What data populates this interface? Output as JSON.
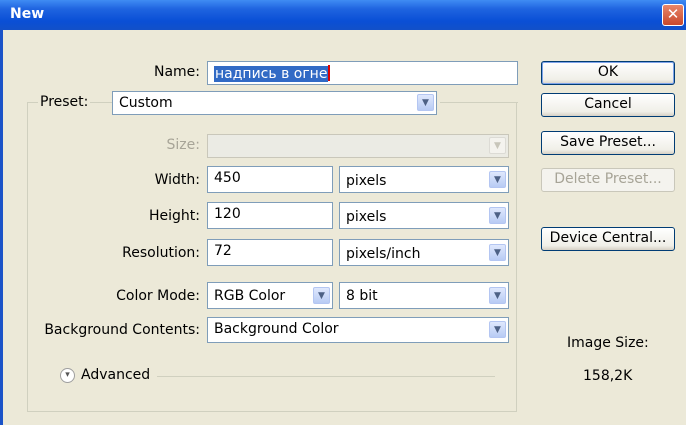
{
  "window": {
    "title": "New",
    "close_glyph": "✕"
  },
  "form": {
    "name_label": "Name:",
    "name_value": "надпись в огне",
    "preset_label": "Preset:",
    "preset_value": "Custom",
    "size_label": "Size:",
    "size_value": "",
    "width_label": "Width:",
    "width_value": "450",
    "width_unit": "pixels",
    "height_label": "Height:",
    "height_value": "120",
    "height_unit": "pixels",
    "resolution_label": "Resolution:",
    "resolution_value": "72",
    "resolution_unit": "pixels/inch",
    "color_mode_label": "Color Mode:",
    "color_mode_value": "RGB Color",
    "bit_depth_value": "8 bit",
    "background_label": "Background Contents:",
    "background_value": "Background Color",
    "advanced_label": "Advanced",
    "advanced_icon": "expand-chevron-icon"
  },
  "buttons": {
    "ok": "OK",
    "cancel": "Cancel",
    "save_preset": "Save Preset...",
    "delete_preset": "Delete Preset...",
    "device_central": "Device Central..."
  },
  "info": {
    "image_size_label": "Image Size:",
    "image_size_value": "158,2K"
  },
  "colors": {
    "titlebar": "#0a4fd6",
    "dialog_bg": "#ece9d8",
    "selection": "#316ac5",
    "close_button": "#c9482b"
  }
}
